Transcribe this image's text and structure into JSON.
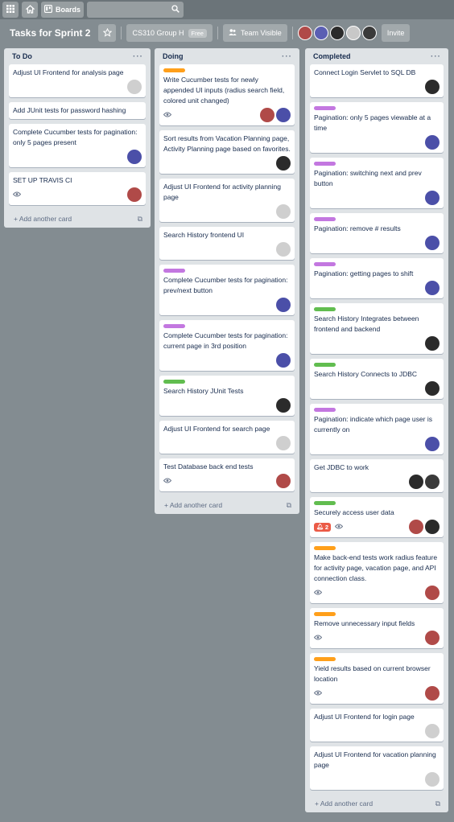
{
  "colors": {
    "background": "#838c91",
    "list_bg": "#dfe3e6",
    "label_orange": "#ff9f1a",
    "label_purple": "#c377e0",
    "label_green": "#61bd4f",
    "notification_red": "#eb5a46"
  },
  "topbar": {
    "apps_icon": "grid-icon",
    "home_icon": "home-icon",
    "boards_label": "Boards",
    "search_icon": "search-icon"
  },
  "board": {
    "title": "Tasks for Sprint 2",
    "team_name": "CS310 Group H",
    "free_label": "Free",
    "visibility_label": "Team Visible",
    "invite_label": "Invite",
    "member_colors": [
      "#b04a48",
      "#5b5fb3",
      "#2b2b2b",
      "#c8c8c8",
      "#3a3a3a"
    ]
  },
  "lists": {
    "todo": {
      "title": "To Do",
      "add_label": "Add another card",
      "cards": [
        {
          "title": "Adjust UI Frontend for analysis page",
          "label": "",
          "watch": false,
          "notif": "",
          "avatars": [
            "#cfcfcf"
          ]
        },
        {
          "title": "Add JUnit tests for password hashing",
          "label": "",
          "watch": false,
          "notif": "",
          "avatars": []
        },
        {
          "title": "Complete Cucumber tests for pagination: only 5 pages present",
          "label": "",
          "watch": false,
          "notif": "",
          "avatars": [
            "#4b4fa8"
          ]
        },
        {
          "title": "SET UP TRAVIS CI",
          "label": "",
          "watch": true,
          "notif": "",
          "avatars": [
            "#b04a48"
          ]
        }
      ]
    },
    "doing": {
      "title": "Doing",
      "add_label": "Add another card",
      "cards": [
        {
          "title": "Write Cucumber tests for newly appended UI inputs (radius search field, colored unit changed)",
          "label": "#ff9f1a",
          "watch": true,
          "notif": "",
          "avatars": [
            "#b04a48",
            "#4b4fa8"
          ]
        },
        {
          "title": "Sort results from Vacation Planning page, Activity Planning page based on favorites.",
          "label": "",
          "watch": false,
          "notif": "",
          "avatars": [
            "#2b2b2b"
          ]
        },
        {
          "title": "Adjust UI Frontend for activity planning page",
          "label": "",
          "watch": false,
          "notif": "",
          "avatars": [
            "#cfcfcf"
          ]
        },
        {
          "title": "Search History frontend UI",
          "label": "",
          "watch": false,
          "notif": "",
          "avatars": [
            "#cfcfcf"
          ]
        },
        {
          "title": "Complete Cucumber tests for pagination: prev/next button",
          "label": "#c377e0",
          "watch": false,
          "notif": "",
          "avatars": [
            "#4b4fa8"
          ]
        },
        {
          "title": "Complete Cucumber tests for pagination: current page in 3rd position",
          "label": "#c377e0",
          "watch": false,
          "notif": "",
          "avatars": [
            "#4b4fa8"
          ]
        },
        {
          "title": "Search History JUnit Tests",
          "label": "#61bd4f",
          "watch": false,
          "notif": "",
          "avatars": [
            "#2b2b2b"
          ]
        },
        {
          "title": "Adjust UI Frontend for search page",
          "label": "",
          "watch": false,
          "notif": "",
          "avatars": [
            "#cfcfcf"
          ]
        },
        {
          "title": "Test Database back end tests",
          "label": "",
          "watch": true,
          "notif": "",
          "avatars": [
            "#b04a48"
          ]
        }
      ]
    },
    "completed": {
      "title": "Completed",
      "add_label": "Add another card",
      "cards": [
        {
          "title": "Connect Login Servlet to SQL DB",
          "label": "",
          "watch": false,
          "notif": "",
          "avatars": [
            "#2b2b2b"
          ]
        },
        {
          "title": "Pagination: only 5 pages viewable at a time",
          "label": "#c377e0",
          "watch": false,
          "notif": "",
          "avatars": [
            "#4b4fa8"
          ]
        },
        {
          "title": "Pagination: switching next and prev button",
          "label": "#c377e0",
          "watch": false,
          "notif": "",
          "avatars": [
            "#4b4fa8"
          ]
        },
        {
          "title": "Pagination: remove # results",
          "label": "#c377e0",
          "watch": false,
          "notif": "",
          "avatars": [
            "#4b4fa8"
          ]
        },
        {
          "title": "Pagination: getting pages to shift",
          "label": "#c377e0",
          "watch": false,
          "notif": "",
          "avatars": [
            "#4b4fa8"
          ]
        },
        {
          "title": "Search History Integrates between frontend and backend",
          "label": "#61bd4f",
          "watch": false,
          "notif": "",
          "avatars": [
            "#2b2b2b"
          ]
        },
        {
          "title": "Search History Connects to JDBC",
          "label": "#61bd4f",
          "watch": false,
          "notif": "",
          "avatars": [
            "#2b2b2b"
          ]
        },
        {
          "title": "Pagination: indicate which page user is currently on",
          "label": "#c377e0",
          "watch": false,
          "notif": "",
          "avatars": [
            "#4b4fa8"
          ]
        },
        {
          "title": "Get JDBC to work",
          "label": "",
          "watch": false,
          "notif": "",
          "avatars": [
            "#2b2b2b",
            "#3a3a3a"
          ]
        },
        {
          "title": "Securely access user data",
          "label": "#61bd4f",
          "watch": true,
          "notif": "2",
          "avatars": [
            "#b04a48",
            "#2b2b2b"
          ]
        },
        {
          "title": "Make back-end tests work radius feature for activity page, vacation page, and API connection class.",
          "label": "#ff9f1a",
          "watch": true,
          "notif": "",
          "avatars": [
            "#b04a48"
          ]
        },
        {
          "title": "Remove unnecessary input fields",
          "label": "#ff9f1a",
          "watch": true,
          "notif": "",
          "avatars": [
            "#b04a48"
          ]
        },
        {
          "title": "Yield results based on current browser location",
          "label": "#ff9f1a",
          "watch": true,
          "notif": "",
          "avatars": [
            "#b04a48"
          ]
        },
        {
          "title": "Adjust UI Frontend for login page",
          "label": "",
          "watch": false,
          "notif": "",
          "avatars": [
            "#cfcfcf"
          ]
        },
        {
          "title": "Adjust UI Frontend for vacation planning page",
          "label": "",
          "watch": false,
          "notif": "",
          "avatars": [
            "#cfcfcf"
          ]
        }
      ]
    }
  }
}
